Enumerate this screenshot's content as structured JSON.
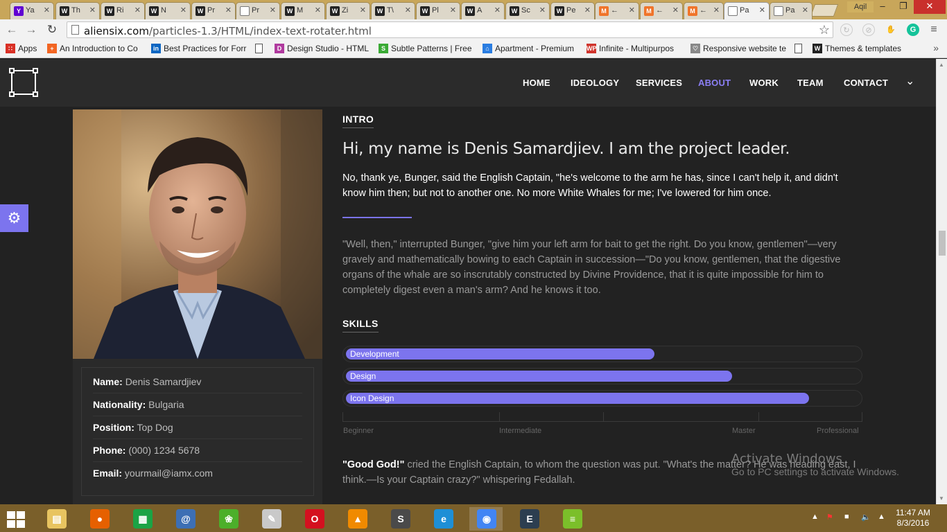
{
  "browser": {
    "tabs": [
      {
        "label": "Ya",
        "icon": "yahoo-icon",
        "color": "#6001d2",
        "glyph": "Y"
      },
      {
        "label": "Th",
        "icon": "themeforest-icon",
        "color": "#222222",
        "glyph": "W"
      },
      {
        "label": "Ri",
        "icon": "themeforest-icon",
        "color": "#222222",
        "glyph": "W"
      },
      {
        "label": "N",
        "icon": "themeforest-icon",
        "color": "#222222",
        "glyph": "W"
      },
      {
        "label": "Pr",
        "icon": "themeforest-icon",
        "color": "#222222",
        "glyph": "W"
      },
      {
        "label": "Pr",
        "icon": "page-icon",
        "color": "#ffffff",
        "glyph": ""
      },
      {
        "label": "M",
        "icon": "themeforest-icon",
        "color": "#222222",
        "glyph": "W"
      },
      {
        "label": "Zi",
        "icon": "themeforest-icon",
        "color": "#222222",
        "glyph": "W"
      },
      {
        "label": "T\\",
        "icon": "themeforest-icon",
        "color": "#222222",
        "glyph": "W"
      },
      {
        "label": "Pl",
        "icon": "themeforest-icon",
        "color": "#222222",
        "glyph": "W"
      },
      {
        "label": "A",
        "icon": "themeforest-icon",
        "color": "#222222",
        "glyph": "W"
      },
      {
        "label": "Sc",
        "icon": "themeforest-icon",
        "color": "#222222",
        "glyph": "W"
      },
      {
        "label": "Pe",
        "icon": "themeforest-icon",
        "color": "#222222",
        "glyph": "W"
      },
      {
        "label": "←",
        "icon": "orange-m-icon",
        "color": "#f0742a",
        "glyph": "M"
      },
      {
        "label": "←",
        "icon": "orange-m-icon",
        "color": "#f0742a",
        "glyph": "M"
      },
      {
        "label": "←",
        "icon": "orange-m-icon",
        "color": "#f0742a",
        "glyph": "M"
      },
      {
        "label": "Pa",
        "icon": "page-icon",
        "color": "#ffffff",
        "glyph": "",
        "active": true
      },
      {
        "label": "Pa",
        "icon": "page-icon",
        "color": "#ffffff",
        "glyph": ""
      }
    ],
    "user": "Aqil",
    "url_host": "aliensix.com",
    "url_path": "/particles-1.3/HTML/index-text-rotater.html",
    "bookmarks": [
      {
        "label": "Apps",
        "color": "#d93025",
        "glyph": "∷"
      },
      {
        "label": "An Introduction to Co",
        "color": "#f26522",
        "glyph": "+"
      },
      {
        "label": "Best Practices for Forr",
        "color": "#0a66c2",
        "glyph": "in"
      },
      {
        "label": "",
        "color": "#ffffff",
        "glyph": ""
      },
      {
        "label": "Design Studio - HTML",
        "color": "#b03a9e",
        "glyph": "D"
      },
      {
        "label": "Subtle Patterns | Free",
        "color": "#3aaa35",
        "glyph": "S"
      },
      {
        "label": "Apartment - Premium",
        "color": "#2a7de1",
        "glyph": "⌂"
      },
      {
        "label": "Infinite - Multipurpos",
        "color": "#d0342c",
        "glyph": "WP"
      },
      {
        "label": "Responsive website te",
        "color": "#888888",
        "glyph": "♡"
      },
      {
        "label": "",
        "color": "#ffffff",
        "glyph": ""
      },
      {
        "label": "Themes & templates",
        "color": "#222222",
        "glyph": "W"
      }
    ]
  },
  "site": {
    "nav": [
      "HOME",
      "IDEOLOGY",
      "SERVICES",
      "ABOUT",
      "WORK",
      "TEAM",
      "CONTACT"
    ],
    "active_nav": "ABOUT",
    "accent": "#7c74ee"
  },
  "profile": {
    "rows": [
      {
        "label": "Name:",
        "value": "Denis Samardjiev"
      },
      {
        "label": "Nationality:",
        "value": "Bulgaria"
      },
      {
        "label": "Position:",
        "value": "Top Dog"
      },
      {
        "label": "Phone:",
        "value": "(000) 1234 5678"
      },
      {
        "label": "Email:",
        "value": "yourmail@iamx.com"
      }
    ]
  },
  "intro": {
    "label": "INTRO",
    "heading": "Hi, my name is Denis Samardjiev. I am the project leader.",
    "lead": "No, thank ye, Bunger, said the English Captain, \"he's welcome to the arm he has, since I can't help it, and didn't know him then; but not to another one. No more White Whales for me; I've lowered for him once.",
    "body": "\"Well, then,\" interrupted Bunger, \"give him your left arm for bait to get the right. Do you know, gentlemen\"—very gravely and mathematically bowing to each Captain in succession—\"Do you know, gentlemen, that the digestive organs of the whale are so inscrutably constructed by Divine Providence, that it is quite impossible for him to completely digest even a man's arm? And he knows it too."
  },
  "skills": {
    "label": "SKILLS",
    "items": [
      {
        "name": "Development",
        "level": 0.6
      },
      {
        "name": "Design",
        "level": 0.75
      },
      {
        "name": "Icon Design",
        "level": 0.9
      }
    ],
    "levels": [
      "Beginner",
      "Intermediate",
      "Master",
      "Professional"
    ]
  },
  "quote": {
    "strong": "\"Good God!\"",
    "text": " cried the English Captain, to whom the question was put. \"What's the matter? He was heading east, I think.—Is your Captain crazy?\" whispering Fedallah."
  },
  "watermark": {
    "title": "Activate Windows",
    "subtitle": "Go to PC settings to activate Windows."
  },
  "taskbar": {
    "apps": [
      {
        "name": "file-explorer-icon",
        "color": "#e8c460",
        "glyph": "▤"
      },
      {
        "name": "firefox-icon",
        "color": "#e66000",
        "glyph": "●"
      },
      {
        "name": "store-icon",
        "color": "#1ba345",
        "glyph": "▦"
      },
      {
        "name": "mail-icon",
        "color": "#3d6fb4",
        "glyph": "@"
      },
      {
        "name": "frog-icon",
        "color": "#4caf2a",
        "glyph": "❀"
      },
      {
        "name": "paint-icon",
        "color": "#c9c9c9",
        "glyph": "✎"
      },
      {
        "name": "opera-icon",
        "color": "#d4101f",
        "glyph": "O"
      },
      {
        "name": "vlc-icon",
        "color": "#f08a00",
        "glyph": "▲"
      },
      {
        "name": "sublime-icon",
        "color": "#4a4a4a",
        "glyph": "S"
      },
      {
        "name": "ie-icon",
        "color": "#1e8fd6",
        "glyph": "e"
      },
      {
        "name": "chrome-icon",
        "color": "#4285f4",
        "glyph": "◉"
      },
      {
        "name": "editor-icon",
        "color": "#2c3e50",
        "glyph": "E"
      },
      {
        "name": "bluestacks-icon",
        "color": "#7bbf2a",
        "glyph": "≡"
      }
    ],
    "time": "11:47 AM",
    "date": "8/3/2016"
  }
}
